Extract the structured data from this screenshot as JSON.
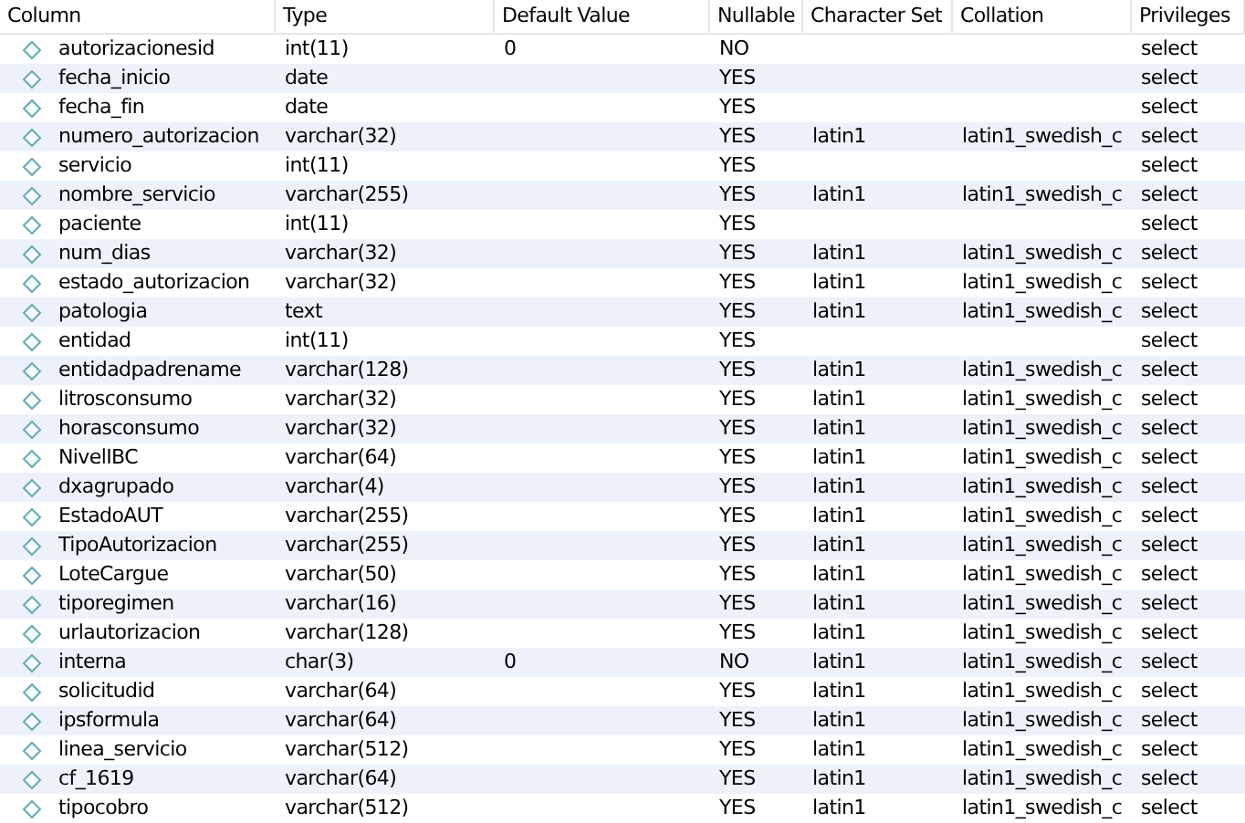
{
  "table": {
    "columns": [
      "Column",
      "Type",
      "Default Value",
      "Nullable",
      "Character Set",
      "Collation",
      "Privileges"
    ],
    "rows": [
      [
        "autorizacionesid",
        "int(11)",
        "0",
        "NO",
        "",
        "",
        "select"
      ],
      [
        "fecha_inicio",
        "date",
        "",
        "YES",
        "",
        "",
        "select"
      ],
      [
        "fecha_fin",
        "date",
        "",
        "YES",
        "",
        "",
        "select"
      ],
      [
        "numero_autorizacion",
        "varchar(32)",
        "",
        "YES",
        "latin1",
        "latin1_swedish_c",
        "select"
      ],
      [
        "servicio",
        "int(11)",
        "",
        "YES",
        "",
        "",
        "select"
      ],
      [
        "nombre_servicio",
        "varchar(255)",
        "",
        "YES",
        "latin1",
        "latin1_swedish_c",
        "select"
      ],
      [
        "paciente",
        "int(11)",
        "",
        "YES",
        "",
        "",
        "select"
      ],
      [
        "num_dias",
        "varchar(32)",
        "",
        "YES",
        "latin1",
        "latin1_swedish_c",
        "select"
      ],
      [
        "estado_autorizacion",
        "varchar(32)",
        "",
        "YES",
        "latin1",
        "latin1_swedish_c",
        "select"
      ],
      [
        "patologia",
        "text",
        "",
        "YES",
        "latin1",
        "latin1_swedish_c",
        "select"
      ],
      [
        "entidad",
        "int(11)",
        "",
        "YES",
        "",
        "",
        "select"
      ],
      [
        "entidadpadrename",
        "varchar(128)",
        "",
        "YES",
        "latin1",
        "latin1_swedish_c",
        "select"
      ],
      [
        "litrosconsumo",
        "varchar(32)",
        "",
        "YES",
        "latin1",
        "latin1_swedish_c",
        "select"
      ],
      [
        "horasconsumo",
        "varchar(32)",
        "",
        "YES",
        "latin1",
        "latin1_swedish_c",
        "select"
      ],
      [
        "NivelIBC",
        "varchar(64)",
        "",
        "YES",
        "latin1",
        "latin1_swedish_c",
        "select"
      ],
      [
        "dxagrupado",
        "varchar(4)",
        "",
        "YES",
        "latin1",
        "latin1_swedish_c",
        "select"
      ],
      [
        "EstadoAUT",
        "varchar(255)",
        "",
        "YES",
        "latin1",
        "latin1_swedish_c",
        "select"
      ],
      [
        "TipoAutorizacion",
        "varchar(255)",
        "",
        "YES",
        "latin1",
        "latin1_swedish_c",
        "select"
      ],
      [
        "LoteCargue",
        "varchar(50)",
        "",
        "YES",
        "latin1",
        "latin1_swedish_c",
        "select"
      ],
      [
        "tiporegimen",
        "varchar(16)",
        "",
        "YES",
        "latin1",
        "latin1_swedish_c",
        "select"
      ],
      [
        "urlautorizacion",
        "varchar(128)",
        "",
        "YES",
        "latin1",
        "latin1_swedish_c",
        "select"
      ],
      [
        "interna",
        "char(3)",
        "0",
        "NO",
        "latin1",
        "latin1_swedish_c",
        "select"
      ],
      [
        "solicitudid",
        "varchar(64)",
        "",
        "YES",
        "latin1",
        "latin1_swedish_c",
        "select"
      ],
      [
        "ipsformula",
        "varchar(64)",
        "",
        "YES",
        "latin1",
        "latin1_swedish_c",
        "select"
      ],
      [
        "linea_servicio",
        "varchar(512)",
        "",
        "YES",
        "latin1",
        "latin1_swedish_c",
        "select"
      ],
      [
        "cf_1619",
        "varchar(64)",
        "",
        "YES",
        "latin1",
        "latin1_swedish_c",
        "select"
      ],
      [
        "tipocobro",
        "varchar(512)",
        "",
        "YES",
        "latin1",
        "latin1_swedish_c",
        "select"
      ]
    ]
  }
}
